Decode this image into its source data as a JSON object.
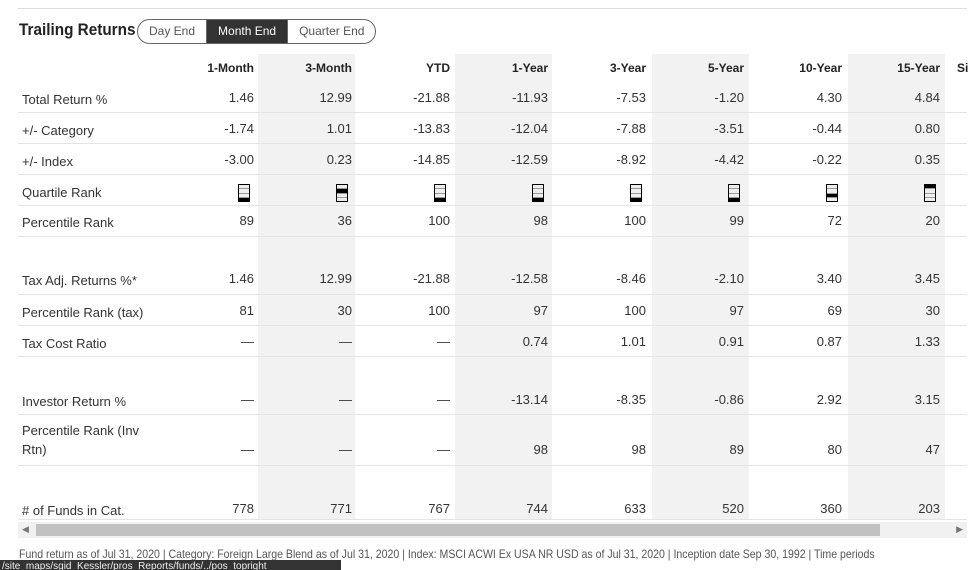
{
  "title": "Trailing Returns",
  "toggle": [
    "Day End",
    "Month End",
    "Quarter End"
  ],
  "toggle_selected": "Month End",
  "columns": [
    "1-Month",
    "3-Month",
    "YTD",
    "1-Year",
    "3-Year",
    "5-Year",
    "10-Year",
    "15-Year",
    "Si"
  ],
  "rows": [
    {
      "label": "Total Return %",
      "values": [
        "1.46",
        "12.99",
        "-21.88",
        "-11.93",
        "-7.53",
        "-1.20",
        "4.30",
        "4.84"
      ]
    },
    {
      "label": "+/- Category",
      "values": [
        "-1.74",
        "1.01",
        "-13.83",
        "-12.04",
        "-7.88",
        "-3.51",
        "-0.44",
        "0.80"
      ]
    },
    {
      "label": "+/- Index",
      "values": [
        "-3.00",
        "0.23",
        "-14.85",
        "-12.59",
        "-8.92",
        "-4.42",
        "-0.22",
        "0.35"
      ]
    },
    {
      "label": "Quartile Rank",
      "quartiles": [
        4,
        2,
        4,
        4,
        4,
        4,
        3,
        1
      ]
    },
    {
      "label": "Percentile Rank",
      "values": [
        "89",
        "36",
        "100",
        "98",
        "100",
        "99",
        "72",
        "20"
      ]
    },
    {
      "label": "Tax Adj. Returns %*",
      "values": [
        "1.46",
        "12.99",
        "-21.88",
        "-12.58",
        "-8.46",
        "-2.10",
        "3.40",
        "3.45"
      ]
    },
    {
      "label": "Percentile Rank (tax)",
      "values": [
        "81",
        "30",
        "100",
        "97",
        "100",
        "97",
        "69",
        "30"
      ]
    },
    {
      "label": "Tax Cost Ratio",
      "values": [
        "—",
        "—",
        "—",
        "0.74",
        "1.01",
        "0.91",
        "0.87",
        "1.33"
      ]
    },
    {
      "label": "Investor Return %",
      "values": [
        "—",
        "—",
        "—",
        "-13.14",
        "-8.35",
        "-0.86",
        "2.92",
        "3.15"
      ]
    },
    {
      "label": "Percentile Rank (Inv Rtn)",
      "values": [
        "—",
        "—",
        "—",
        "98",
        "98",
        "89",
        "80",
        "47"
      ]
    },
    {
      "label": "# of Funds in Cat.",
      "values": [
        "778",
        "771",
        "767",
        "744",
        "633",
        "520",
        "360",
        "203"
      ]
    }
  ],
  "footer": "Fund return as of Jul 31, 2020 | Category: Foreign Large Blend as of Jul 31, 2020 | Index: MSCI ACWI Ex USA NR USD as of Jul 31, 2020 | Inception date Sep 30, 1992 | Time periods",
  "status_tooltip": "/site_maps/sgid_Kessler/pros_Reports/funds/../pos_topright"
}
